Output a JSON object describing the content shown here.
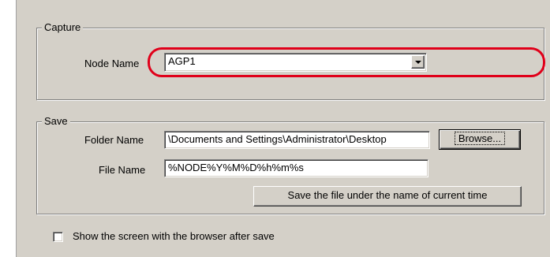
{
  "capture": {
    "legend": "Capture",
    "node_name_label": "Node Name",
    "node_name_value": "AGP1"
  },
  "save": {
    "legend": "Save",
    "folder_name_label": "Folder Name",
    "folder_name_value": "\\Documents and Settings\\Administrator\\Desktop",
    "browse_button": "Browse...",
    "file_name_label": "File Name",
    "file_name_value": "%NODE%Y%M%D%h%m%s",
    "save_current_time_button": "Save the file under the name of current time"
  },
  "options": {
    "show_browser_label": "Show the screen with the browser after save",
    "show_browser_checked": false
  },
  "colors": {
    "dialog_face": "#d4d0c8",
    "highlight_ring": "#e0001a"
  }
}
